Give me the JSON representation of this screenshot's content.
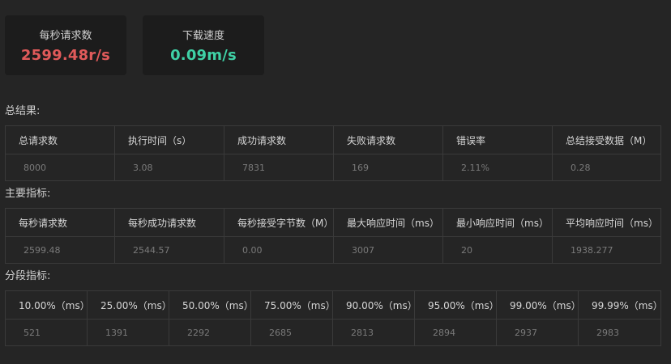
{
  "cards": {
    "rps": {
      "label": "每秒请求数",
      "value": "2599.48r/s",
      "color": "#e05a5a"
    },
    "download": {
      "label": "下载速度",
      "value": "0.09m/s",
      "color": "#3fd1a6"
    }
  },
  "summary": {
    "title": "总结果:",
    "headers": [
      "总请求数",
      "执行时间（s）",
      "成功请求数",
      "失败请求数",
      "错误率",
      "总结接受数据（M）"
    ],
    "values": [
      "8000",
      "3.08",
      "7831",
      "169",
      "2.11%",
      "0.28"
    ]
  },
  "main": {
    "title": "主要指标:",
    "headers": [
      "每秒请求数",
      "每秒成功请求数",
      "每秒接受字节数（M）",
      "最大响应时间（ms）",
      "最小响应时间（ms）",
      "平均响应时间（ms）"
    ],
    "values": [
      "2599.48",
      "2544.57",
      "0.00",
      "3007",
      "20",
      "1938.277"
    ]
  },
  "percentiles": {
    "title": "分段指标:",
    "headers": [
      "10.00%（ms）",
      "25.00%（ms）",
      "50.00%（ms）",
      "75.00%（ms）",
      "90.00%（ms）",
      "95.00%（ms）",
      "99.00%（ms）",
      "99.99%（ms）"
    ],
    "values": [
      "521",
      "1391",
      "2292",
      "2685",
      "2813",
      "2894",
      "2937",
      "2983"
    ]
  }
}
